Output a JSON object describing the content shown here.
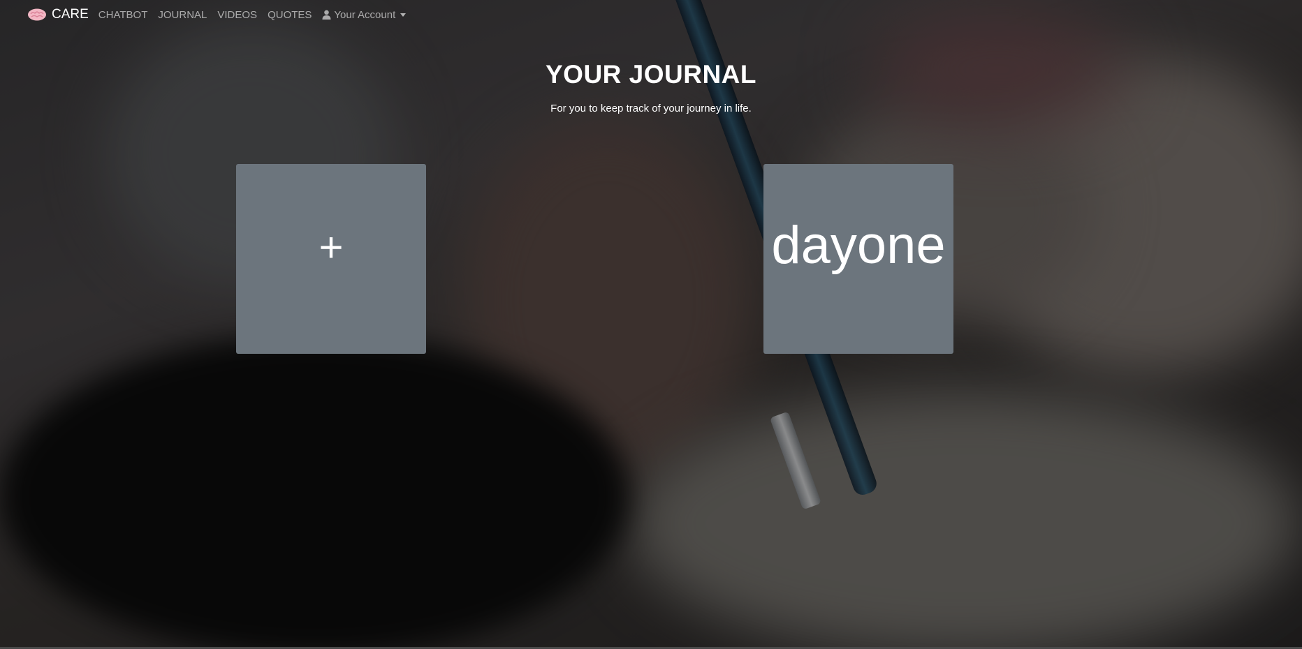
{
  "navbar": {
    "brand_label": "CARE",
    "brand_icon": "brain-icon",
    "links": [
      {
        "label": "CHATBOT"
      },
      {
        "label": "JOURNAL"
      },
      {
        "label": "VIDEOS"
      },
      {
        "label": "QUOTES"
      }
    ],
    "account": {
      "label": "Your Account",
      "icon": "user-icon"
    }
  },
  "header": {
    "title": "YOUR JOURNAL",
    "subtitle": "For you to keep track of your journey in life."
  },
  "cards": {
    "add_label": "+",
    "entries": [
      {
        "label": "dayone"
      }
    ]
  },
  "colors": {
    "card_bg": "#6c757d",
    "text": "#ffffff",
    "nav_link": "rgba(255,255,255,0.6)"
  }
}
